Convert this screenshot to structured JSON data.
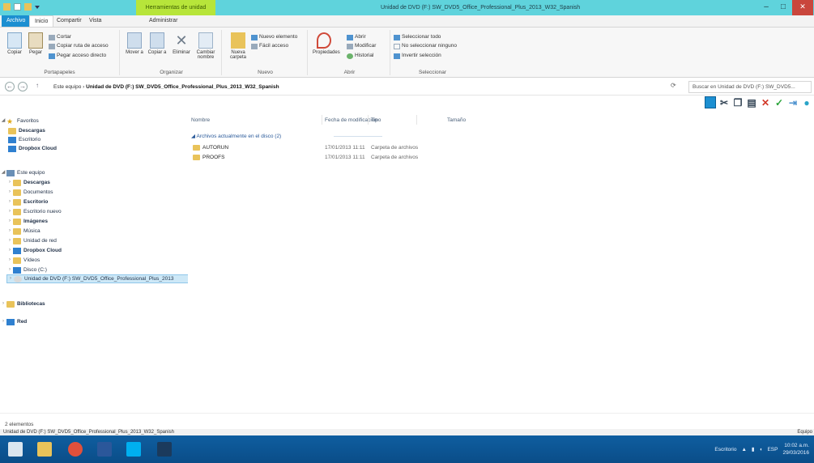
{
  "window": {
    "context_tab": "Herramientas de unidad",
    "title": "Unidad de DVD (F:) SW_DVD5_Office_Professional_Plus_2013_W32_Spanish",
    "min_glyph": "–",
    "max_glyph": "□",
    "close_glyph": "✕"
  },
  "ribbon": {
    "tabs": [
      "Archivo",
      "Inicio",
      "Compartir",
      "Vista",
      "Administrar"
    ],
    "groups": {
      "portapapeles": {
        "label": "Portapapeles",
        "copy": "Copiar",
        "paste": "Pegar",
        "cut": "Cortar",
        "copy_path": "Copiar ruta de acceso",
        "paste_shortcut": "Pegar acceso directo"
      },
      "organizar": {
        "label": "Organizar",
        "move_to": "Mover a",
        "copy_to": "Copiar a",
        "delete": "Eliminar",
        "rename": "Cambiar nombre"
      },
      "nuevo": {
        "label": "Nuevo",
        "new_folder": "Nueva carpeta",
        "new_item": "Nuevo elemento",
        "easy_access": "Fácil acceso"
      },
      "abrir": {
        "label": "Abrir",
        "properties": "Propiedades",
        "open": "Abrir",
        "edit": "Modificar",
        "history": "Historial"
      },
      "seleccionar": {
        "label": "Seleccionar",
        "select_all": "Seleccionar todo",
        "select_none": "No seleccionar ninguno",
        "invert": "Invertir selección"
      }
    }
  },
  "address": {
    "back": "←",
    "forward": "→",
    "up": "↑",
    "path_prefix": "Este equipo",
    "path_sep": "›",
    "path_leaf": "Unidad de DVD (F:) SW_DVD5_Office_Professional_Plus_2013_W32_Spanish",
    "refresh": "⟳",
    "search_placeholder": "Buscar en Unidad de DVD (F:) SW_DVD5..."
  },
  "toolbar_icons": [
    "view",
    "cut",
    "copy",
    "paste",
    "delete",
    "check",
    "move",
    "globe"
  ],
  "navpane": {
    "favorites": "Favoritos",
    "fav_items": [
      "Descargas",
      "Escritorio",
      "Dropbox Cloud"
    ],
    "this_pc": "Este equipo",
    "pc_items": [
      "Descargas",
      "Documentos",
      "Escritorio",
      "Escritorio nuevo",
      "Imágenes",
      "Música",
      "Unidad de red",
      "Dropbox Cloud",
      "Vídeos",
      "Disco (C:)"
    ],
    "dvd_item": "Unidad de DVD (F:) SW_DVD5_Office_Professional_Plus_2013",
    "libraries": "Bibliotecas",
    "network": "Red"
  },
  "content": {
    "columns": [
      "Nombre",
      "Fecha de modificación",
      "Tipo",
      "Tamaño"
    ],
    "group_header": "Archivos actualmente en el disco (2)",
    "rows": [
      {
        "name": "AUTORUN",
        "date": "17/01/2013 11:11",
        "type": "Carpeta de archivos"
      },
      {
        "name": "PROOFS",
        "date": "17/01/2013 11:11",
        "type": "Carpeta de archivos"
      }
    ]
  },
  "status": {
    "items_count": "2 elementos",
    "detail": "Unidad de DVD (F:) SW_DVD5_Office_Professional_Plus_2013_W32_Spanish",
    "right": "Equipo"
  },
  "taskbar": {
    "clock_time": "10:02 a.m.",
    "clock_date": "29/03/2016",
    "lang": "ESP",
    "tray_label": "Escritorio"
  },
  "colors": {
    "title_bar": "#5fd3dc",
    "context_tab": "#b7e53a",
    "close_button": "#c9463c",
    "taskbar": "#0f5ea0",
    "accent": "#1c8fd1",
    "selection": "#cde8f7"
  }
}
